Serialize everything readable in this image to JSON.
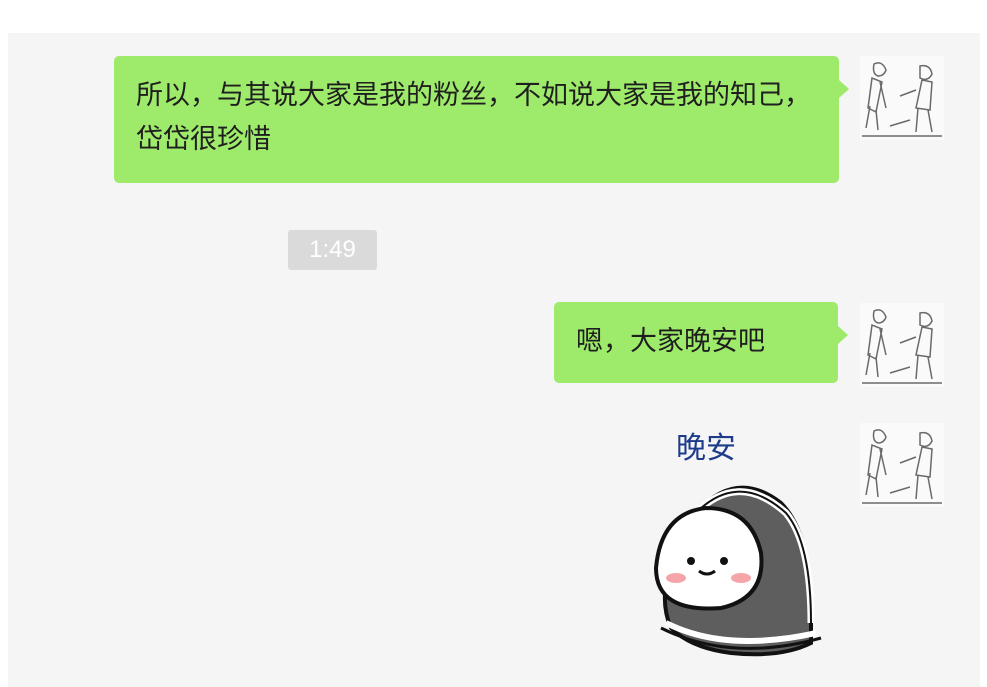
{
  "chat": {
    "messages": [
      {
        "id": "m1",
        "sender": "self",
        "type": "text",
        "text": "所以，与其说大家是我的粉丝，不如说大家是我的知己，岱岱很珍惜"
      },
      {
        "id": "m2",
        "type": "timestamp",
        "text": "1:49"
      },
      {
        "id": "m3",
        "sender": "self",
        "type": "text",
        "text": "嗯，大家晚安吧"
      },
      {
        "id": "m4",
        "sender": "self",
        "type": "sticker",
        "sticker_text": "晚安",
        "sticker": "sleepy-blanket-sticker"
      }
    ]
  },
  "colors": {
    "bubble": "#9eea6a",
    "chat_background": "#f5f5f5",
    "timestamp_background": "#dadada"
  }
}
